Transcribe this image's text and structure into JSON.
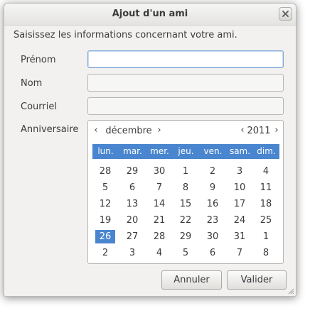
{
  "window": {
    "title": "Ajout d'un ami"
  },
  "form": {
    "instructions": "Saisissez les informations concernant votre ami.",
    "firstname_label": "Prénom",
    "firstname_value": "",
    "lastname_label": "Nom",
    "lastname_value": "",
    "email_label": "Courriel",
    "email_value": "",
    "birthday_label": "Anniversaire"
  },
  "calendar": {
    "month": "décembre",
    "year": "2011",
    "prev_glyph": "‹",
    "next_glyph": "›",
    "weekdays": [
      "lun.",
      "mar.",
      "mer.",
      "jeu.",
      "ven.",
      "sam.",
      "dim."
    ],
    "weeks": [
      [
        "28",
        "29",
        "30",
        "1",
        "2",
        "3",
        "4"
      ],
      [
        "5",
        "6",
        "7",
        "8",
        "9",
        "10",
        "11"
      ],
      [
        "12",
        "13",
        "14",
        "15",
        "16",
        "17",
        "18"
      ],
      [
        "19",
        "20",
        "21",
        "22",
        "23",
        "24",
        "25"
      ],
      [
        "26",
        "27",
        "28",
        "29",
        "30",
        "31",
        "1"
      ],
      [
        "2",
        "3",
        "4",
        "5",
        "6",
        "7",
        "8"
      ]
    ],
    "selected_day": "26"
  },
  "buttons": {
    "cancel": "Annuler",
    "ok": "Valider"
  },
  "colors": {
    "accent": "#4a86cf",
    "focus_border": "#7ea6d6"
  }
}
